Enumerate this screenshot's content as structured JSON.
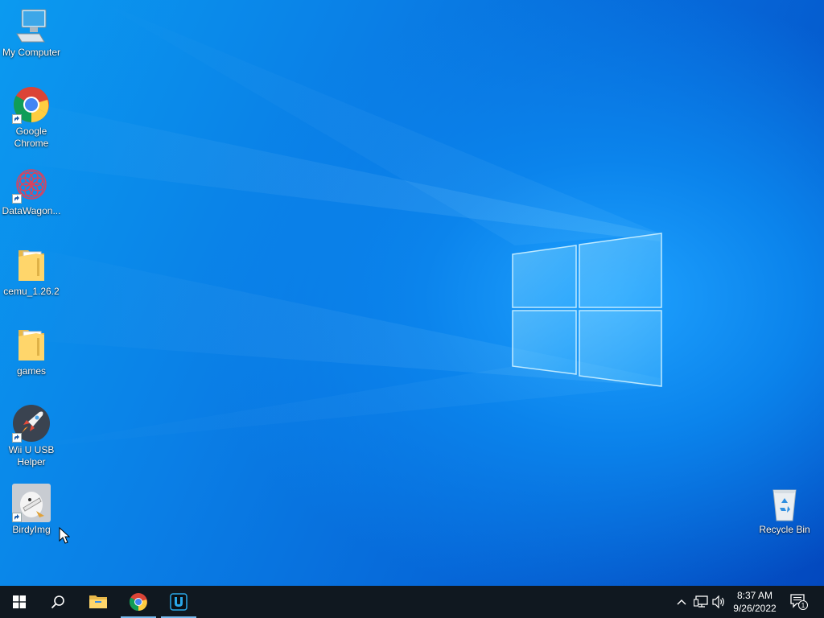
{
  "desktop": {
    "icons": [
      {
        "label": "My Computer",
        "icon": "computer-icon"
      },
      {
        "label": "Google Chrome",
        "icon": "chrome-icon"
      },
      {
        "label": "DataWagon...",
        "icon": "datawagon-icon"
      },
      {
        "label": "cemu_1.26.2",
        "icon": "folder-icon"
      },
      {
        "label": "games",
        "icon": "folder-icon"
      },
      {
        "label": "Wii U USB Helper",
        "icon": "rocket-icon"
      },
      {
        "label": "BirdyImg",
        "icon": "birdyimg-icon"
      }
    ],
    "recycle_bin": {
      "label": "Recycle Bin",
      "icon": "recycle-bin-icon"
    }
  },
  "taskbar": {
    "start": {
      "icon": "windows-logo-icon"
    },
    "search": {
      "icon": "search-icon"
    },
    "pinned": [
      {
        "name": "File Explorer",
        "icon": "folder-icon"
      },
      {
        "name": "Google Chrome",
        "icon": "chrome-icon",
        "active": true
      },
      {
        "name": "Wii U USB Helper",
        "icon": "u-icon",
        "active": true
      }
    ],
    "tray": {
      "icons": [
        "chevron-up-icon",
        "network-icon",
        "volume-icon"
      ],
      "time": "8:37 AM",
      "date": "9/26/2022",
      "notification_count": "1"
    }
  },
  "colors": {
    "taskbar": "#101820",
    "accent": "#76b9ed",
    "wallpaper": "#0a7fe6"
  }
}
